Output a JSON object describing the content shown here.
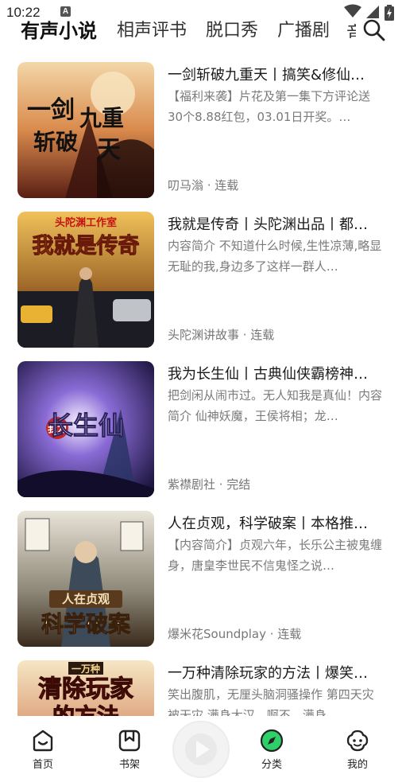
{
  "status_bar": {
    "time": "10:22",
    "notification_badge": "A"
  },
  "tabs": [
    {
      "label": "有声小说",
      "active": true
    },
    {
      "label": "相声评书",
      "active": false
    },
    {
      "label": "脱口秀",
      "active": false
    },
    {
      "label": "广播剧",
      "active": false
    },
    {
      "label": "音",
      "active": false
    }
  ],
  "search": {
    "icon": "search-icon"
  },
  "items": [
    {
      "title": "一剑斩破九重天丨搞笑&修仙…",
      "desc": "【福利来袭】片花及第一集下方评论送30个8.88红包，03.01日开奖。…",
      "meta": "叨马滃 · 连载",
      "cover_text": [
        "一剑",
        "斩破",
        "九重",
        "天"
      ]
    },
    {
      "title": "我就是传奇丨头陀渊出品丨都…",
      "desc": "内容简介 不知道什么时候,生性凉薄,略显无耻的我,身边多了这样一群人…",
      "meta": "头陀渊讲故事 · 连载",
      "cover_text": [
        "头陀渊工作室",
        "我就是传奇"
      ]
    },
    {
      "title": "我为长生仙丨古典仙侠霸榜神…",
      "desc": "把剑闲从闹市过。无人知我是真仙！内容简介 仙神妖魔，王侯将相；龙…",
      "meta": "紫襟剧社 · 完结",
      "cover_text": [
        "我为",
        "长生仙"
      ]
    },
    {
      "title": "人在贞观，科学破案丨本格推…",
      "desc": "【内容简介】贞观六年，长乐公主被鬼缠身，唐皇李世民不信鬼怪之说…",
      "meta": "爆米花Soundplay · 连载",
      "cover_text": [
        "人在贞观",
        "科学破案"
      ]
    },
    {
      "title": "一万种清除玩家的方法丨爆笑…",
      "desc": "笑出腹肌，无厘头脑洞骚操作 第四天灾被天灾 满身大汉，啊不，满身…",
      "meta": "",
      "cover_text": [
        "一万种",
        "清除玩家",
        "的方法"
      ]
    }
  ],
  "bottom_nav": [
    {
      "label": "首页",
      "icon": "home-icon"
    },
    {
      "label": "书架",
      "icon": "bookshelf-icon"
    },
    {
      "label": "",
      "icon": "play-icon"
    },
    {
      "label": "分类",
      "icon": "compass-icon"
    },
    {
      "label": "我的",
      "icon": "profile-icon"
    }
  ],
  "colors": {
    "accent_green": "#2fd06a",
    "text_primary": "#1a1a1a",
    "text_secondary": "#7a7a7a"
  }
}
